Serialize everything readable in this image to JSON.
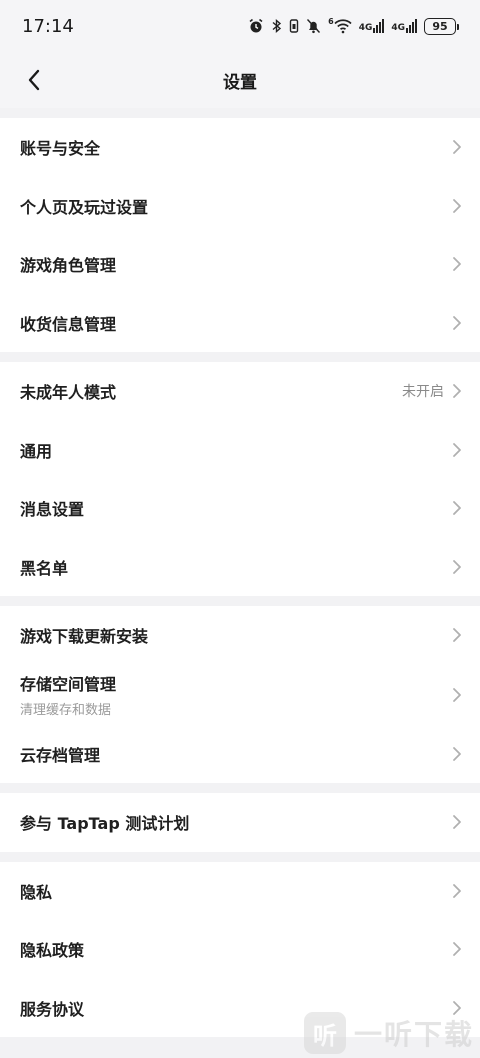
{
  "status_bar": {
    "time": "17:14",
    "battery": "95",
    "net1": "4G",
    "net2": "4G",
    "wifi_badge": "6"
  },
  "header": {
    "title": "设置"
  },
  "groups": [
    {
      "items": [
        {
          "label": "账号与安全"
        },
        {
          "label": "个人页及玩过设置"
        },
        {
          "label": "游戏角色管理"
        },
        {
          "label": "收货信息管理"
        }
      ]
    },
    {
      "items": [
        {
          "label": "未成年人模式",
          "value": "未开启"
        },
        {
          "label": "通用"
        },
        {
          "label": "消息设置"
        },
        {
          "label": "黑名单"
        }
      ]
    },
    {
      "items": [
        {
          "label": "游戏下载更新安装"
        },
        {
          "label": "存储空间管理",
          "sublabel": "清理缓存和数据"
        },
        {
          "label": "云存档管理"
        }
      ]
    },
    {
      "items": [
        {
          "label": "参与 TapTap 测试计划"
        }
      ]
    },
    {
      "items": [
        {
          "label": "隐私"
        },
        {
          "label": "隐私政策"
        },
        {
          "label": "服务协议"
        }
      ]
    }
  ],
  "watermark": {
    "logo_char": "听",
    "text": "一听下载"
  },
  "colors": {
    "background": "#f2f2f4",
    "card": "#ffffff",
    "text_primary": "#1f1f1f",
    "text_secondary": "#8a8a8a",
    "chevron": "#b0b0b0"
  }
}
